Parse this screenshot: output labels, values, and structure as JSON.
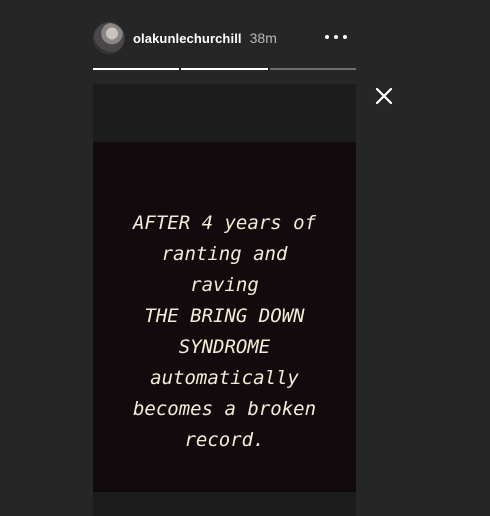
{
  "story": {
    "username": "olakunlechurchill",
    "time_ago": "38m",
    "progress": [
      1.0,
      1.0,
      0.0
    ],
    "text_lines": [
      "AFTER 4 years of",
      "ranting and",
      "raving",
      "THE BRING DOWN",
      "SYNDROME",
      "automatically",
      "becomes a broken",
      "record."
    ]
  },
  "icons": {
    "more": "more-horizontal-icon",
    "close": "close-icon"
  }
}
